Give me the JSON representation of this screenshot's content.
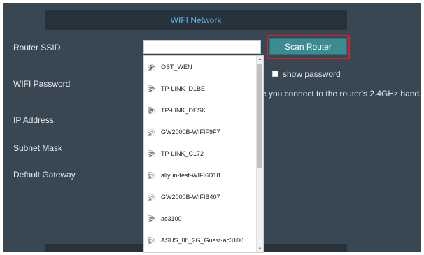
{
  "header": {
    "title": "WIFI Network"
  },
  "form": {
    "ssid_label": "Router SSID",
    "ssid_value": "",
    "password_label": "WIFI Password",
    "ip_label": "IP Address",
    "subnet_label": "Subnet Mask",
    "gateway_label": "Default Gateway"
  },
  "scan_button": {
    "label": "Scan Router"
  },
  "show_password": {
    "label": "show password",
    "checked": false
  },
  "hint": "re you connect to the router's 2.4GHz band.",
  "dropdown": {
    "items": [
      {
        "ssid": "OST_WEN",
        "icon": "wifi-locked-icon"
      },
      {
        "ssid": "TP-LINK_D1BE",
        "icon": "wifi-locked-icon"
      },
      {
        "ssid": "TP-LINK_DESK",
        "icon": "wifi-locked-icon"
      },
      {
        "ssid": "GW2000B-WIFIF9F7",
        "icon": "wifi-icon"
      },
      {
        "ssid": "TP-LINK_C172",
        "icon": "wifi-locked-icon"
      },
      {
        "ssid": "aliyun-test-WIFI6D18",
        "icon": "wifi-icon"
      },
      {
        "ssid": "GW2000B-WIFIB407",
        "icon": "wifi-icon"
      },
      {
        "ssid": "ac3100",
        "icon": "wifi-locked-icon"
      },
      {
        "ssid": "ASUS_08_2G_Guest-ac3100",
        "icon": "wifi-icon"
      }
    ]
  },
  "colors": {
    "panel_bg": "#394753",
    "header_bg": "#27323b",
    "header_text": "#5fb6e6",
    "button_bg": "#3c8a92",
    "highlight_border": "#d9202a"
  }
}
